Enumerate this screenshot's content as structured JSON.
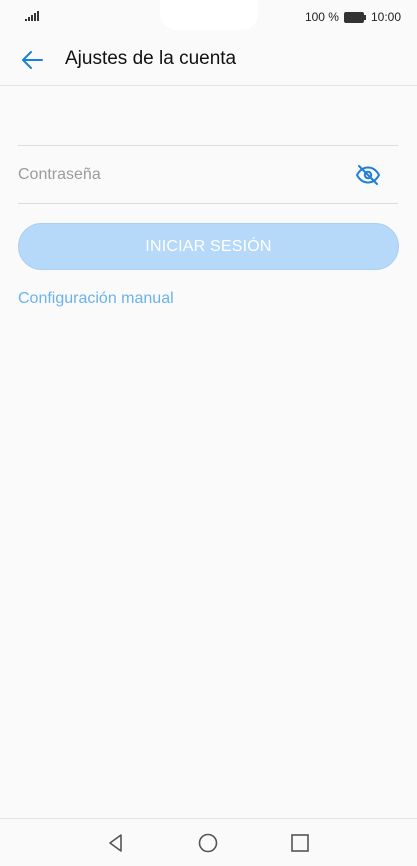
{
  "status_bar": {
    "battery_percent": "100 %",
    "time": "10:00"
  },
  "header": {
    "title": "Ajustes de la cuenta"
  },
  "form": {
    "email_value": "",
    "password_placeholder": "Contraseña",
    "login_label": "INICIAR SESIÓN",
    "manual_config_label": "Configuración manual"
  },
  "icons": {
    "back": "arrow-left-icon",
    "visibility": "eye-off-icon",
    "nav_back": "triangle-back-icon",
    "nav_home": "circle-home-icon",
    "nav_recent": "square-recent-icon"
  },
  "colors": {
    "accent": "#1e7fd6",
    "button_disabled": "#b6d8f9",
    "link": "#6bb3ec"
  }
}
